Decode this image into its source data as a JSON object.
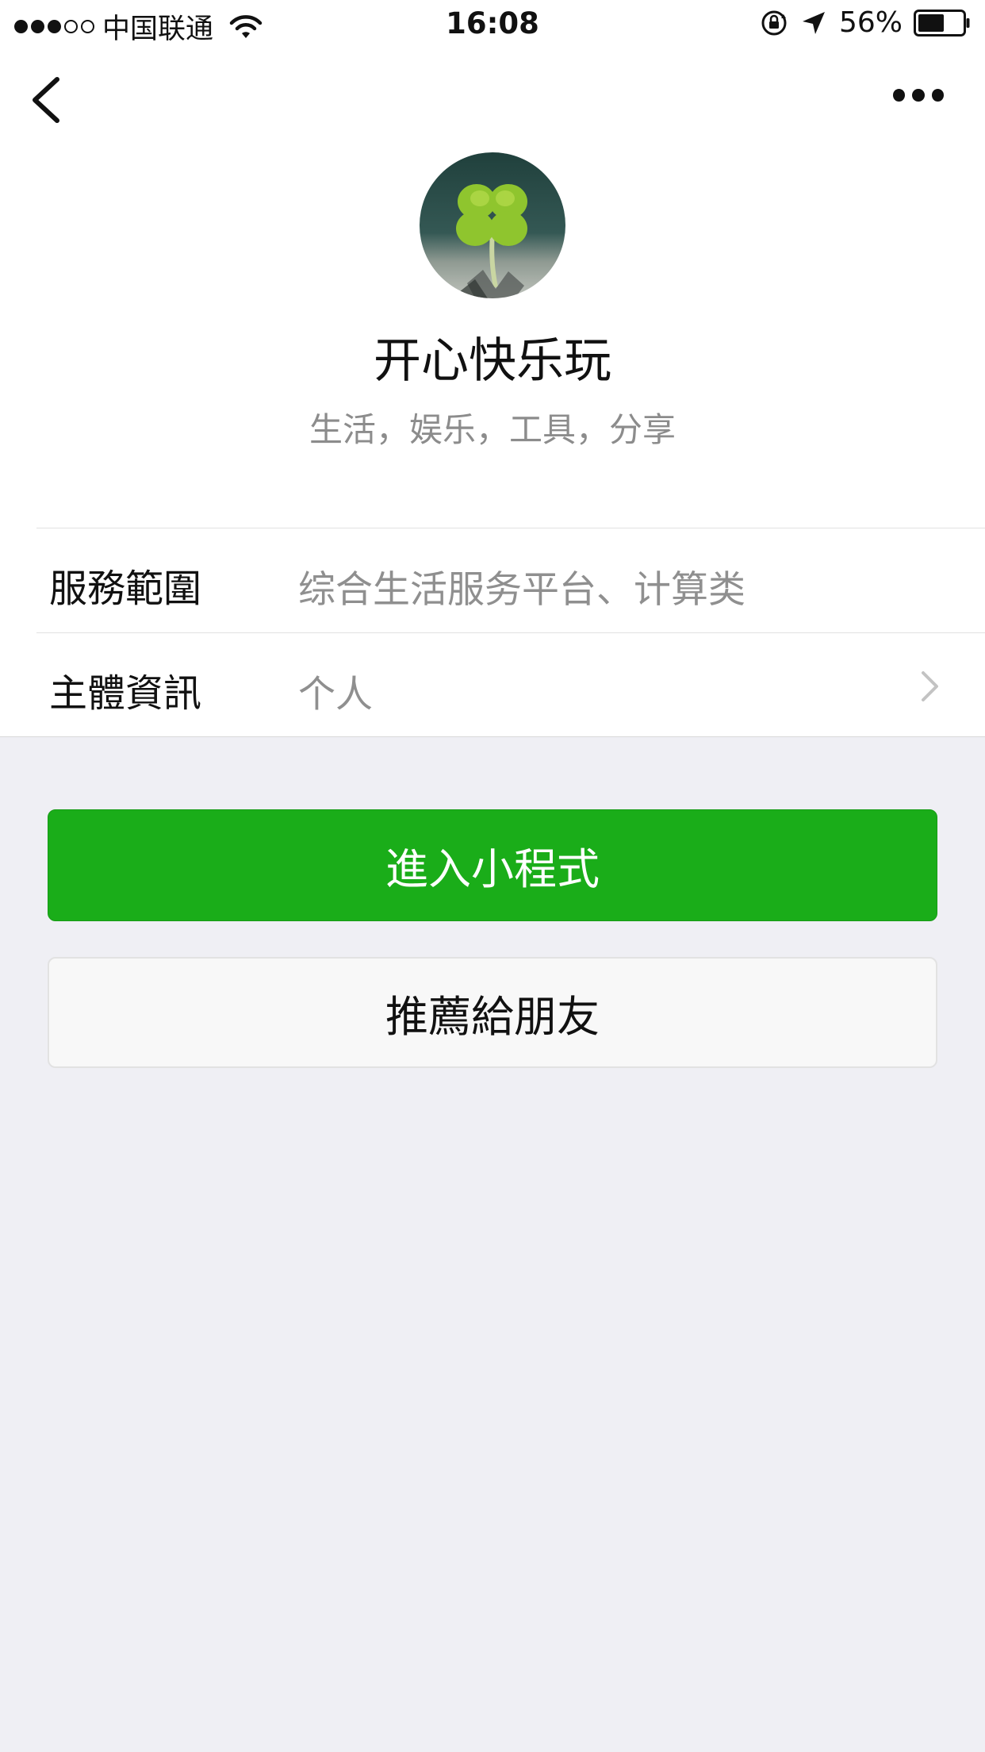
{
  "status_bar": {
    "carrier": "中国联通",
    "time": "16:08",
    "battery": "56%",
    "signal_dots_filled": 3,
    "signal_dots_total": 5,
    "battery_level": 0.56
  },
  "nav": {
    "back_icon": "chevron-left-icon",
    "more_icon": "more-dots-icon"
  },
  "profile": {
    "name": "开心快乐玩",
    "tags": "生活，娱乐，工具，分享",
    "avatar_icon": "four-leaf-clover-avatar"
  },
  "info": {
    "service_label": "服務範圍",
    "service_value": "综合生活服务平台、计算类",
    "subject_label": "主體資訊",
    "subject_value": "个人"
  },
  "buttons": {
    "enter_label": "進入小程式",
    "share_label": "推薦給朋友"
  },
  "colors": {
    "primary_green": "#1aad19",
    "background": "#efeff4"
  }
}
